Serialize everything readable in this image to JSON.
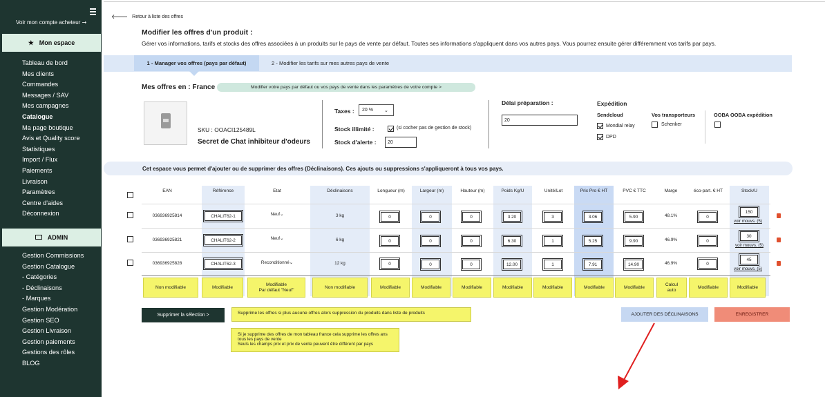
{
  "sidebar": {
    "buyer_link": "Voir mon compte acheteur ➞",
    "mon_espace": "Mon espace",
    "items": [
      "Tableau de bord",
      "Mes clients",
      "Commandes",
      "Messages / SAV",
      "Mes campagnes",
      "Catalogue",
      "Ma page boutique",
      "Avis et Quality score",
      "Statistiques",
      "Import / Flux",
      "Paiements",
      "Livraison",
      "Paramètres",
      "Centre d'aides",
      "Déconnexion"
    ],
    "active_item": "Catalogue",
    "admin": "ADMIN",
    "admin_items": [
      "Gestion Commissions",
      "Gestion Catalogue",
      "- Catégories",
      "- Déclinaisons",
      "- Marques",
      "Gestion Modération",
      "Gestion SEO",
      "Gestion Livraison",
      "Gestion paiements",
      "Gestions des rôles",
      "BLOG"
    ]
  },
  "page": {
    "back": "Retour à liste des offres",
    "title": "Modifier les offres d'un produit :",
    "description": "Gérer vos informations, tarifs et stocks des offres associées à un produits sur le pays de vente par défaut. Toutes ses informations s'appliquent dans vos autres pays. Vous pourrez ensuite gérer différemment vos tarifs par pays.",
    "tab1": "1 - Manager vos offres (pays par défaut)",
    "tab2": "2 - Modifier les tarifs sur mes autres pays de vente",
    "offers_title": "Mes offres en : France",
    "country_pill": "Modifier votre pays par défaut ou vos pays de vente dans les paramètres de votre compte >"
  },
  "product": {
    "sku": "SKU : OOACI125489L",
    "name": "Secret de Chat inhibiteur d'odeurs"
  },
  "settings": {
    "taxes_label": "Taxes :",
    "taxes_value": "20 %",
    "stock_illimite_label": "Stock illimité :",
    "stock_illimite_note": "(si cocher pas de gestion de stock)",
    "stock_alerte_label": "Stock d'alerte :",
    "stock_alerte_value": "20",
    "delai_label": "Délai préparation :",
    "delai_value": "20",
    "expedition_label": "Expédition",
    "sendcloud_label": "Sendcloud",
    "mondial_relay": "Mondial relay",
    "dpd": "DPD",
    "transporteurs_label": "Vos transporteurs",
    "schenker": "Schenker",
    "ooba_label": "OOBA OOBA expédition"
  },
  "banner": "Cet espace vous permet d'ajouter ou de supprimer des offres (Déclinaisons). Ces ajouts ou suppressions s'appliqueront à tous vos pays.",
  "table": {
    "headers": [
      "EAN",
      "Référence",
      "Etat",
      "Déclinaisons",
      "Longueur (m)",
      "Largeur (m)",
      "Hauteur (m)",
      "Poids Kg/U",
      "Unité/Lot",
      "Prix Pro € HT",
      "PVC € TTC",
      "Marge",
      "éco-part. € HT",
      "Stock/U"
    ],
    "rows": [
      {
        "ean": "036936925814",
        "ref": "CHALIT62-1",
        "etat": "Neuf",
        "decl": "3 kg",
        "longueur": "0",
        "largeur": "0",
        "hauteur": "0",
        "poids": "3.20",
        "unite": "3",
        "prix_pro": "3.06",
        "pvc": "5.90",
        "marge": "48.1%",
        "eco": "0",
        "stock": "150",
        "stock_link": "voir mouvs. (5)"
      },
      {
        "ean": "036936925821",
        "ref": "CHALIT62-2",
        "etat": "Neuf",
        "decl": "6 kg",
        "longueur": "0",
        "largeur": "0",
        "hauteur": "0",
        "poids": "6.30",
        "unite": "1",
        "prix_pro": "5.25",
        "pvc": "9.90",
        "marge": "46.9%",
        "eco": "0",
        "stock": "30",
        "stock_link": "voir mouvs. (5)"
      },
      {
        "ean": "036936925828",
        "ref": "CHALIT62-3",
        "etat": "Reconditionné",
        "decl": "12 kg",
        "longueur": "0",
        "largeur": "0",
        "hauteur": "0",
        "poids": "12.00",
        "unite": "1",
        "prix_pro": "7.91",
        "pvc": "14.90",
        "marge": "46.9%",
        "eco": "0",
        "stock": "45",
        "stock_link": "voir mouvs. (5)"
      }
    ],
    "notes": [
      "Non modifiable",
      "Modifiable",
      "Modifiable\nPar défaut \"Neuf\"",
      "Non modifiable",
      "Modifiable",
      "Modifiable",
      "Modifiable",
      "Modifiable",
      "Modifiable",
      "Modifiable",
      "Modifiable",
      "Calcul\nauto",
      "Modifiable",
      "Modifiable"
    ]
  },
  "actions": {
    "delete_selection": "Supprimer la sélection >",
    "note1": "Supprime les offres si plus aucune offres alors suppression du produits dans liste de produits",
    "note2_line1": "Si je supprime des offres de mon tableau france cela supprime les offres ans tous les pays de vente",
    "note2_line2": "Seuls les champs prix et prix de vente peuvent être différent par pays",
    "add_variations": "AJOUTER DES DÉCLINAISONS",
    "save": "ENREGISTRER"
  },
  "colors": {
    "sidebar": "#1e3530",
    "highlight_col": "#dde8f7",
    "note": "#f5f56b",
    "save": "#f08c78",
    "arrow": "#e02020"
  }
}
